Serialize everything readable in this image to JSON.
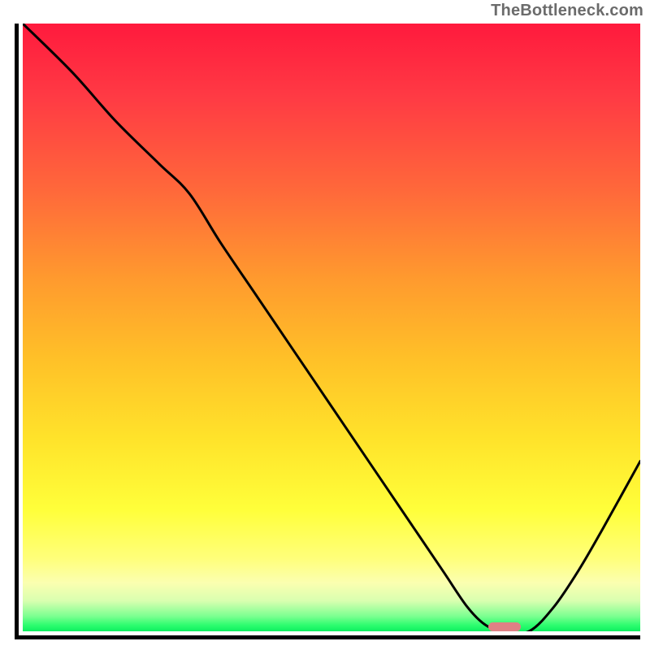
{
  "watermark": {
    "text": "TheBottleneck.com"
  },
  "colors": {
    "gradient_top": "#ff1a3d",
    "gradient_bottom": "#0ef060",
    "curve": "#000000",
    "axes": "#000000",
    "marker": "#e08085"
  },
  "chart_data": {
    "type": "line",
    "title": "",
    "xlabel": "",
    "ylabel": "",
    "xlim": [
      0,
      100
    ],
    "ylim": [
      0,
      100
    ],
    "grid": false,
    "legend": false,
    "background": "vertical-gradient-red-to-green",
    "series": [
      {
        "name": "bottleneck-curve",
        "x": [
          0,
          8,
          15,
          22,
          27,
          32,
          38,
          44,
          50,
          56,
          62,
          68,
          72,
          75,
          78,
          82,
          86,
          90,
          94,
          100
        ],
        "values": [
          100,
          92,
          84,
          77,
          72,
          64,
          55,
          46,
          37,
          28,
          19,
          10,
          4,
          1,
          0,
          0,
          4,
          10,
          17,
          28
        ]
      }
    ],
    "annotations": [
      {
        "name": "optimal-marker",
        "x": 78,
        "y": 0,
        "width_pct": 5.2,
        "shape": "pill"
      }
    ]
  }
}
